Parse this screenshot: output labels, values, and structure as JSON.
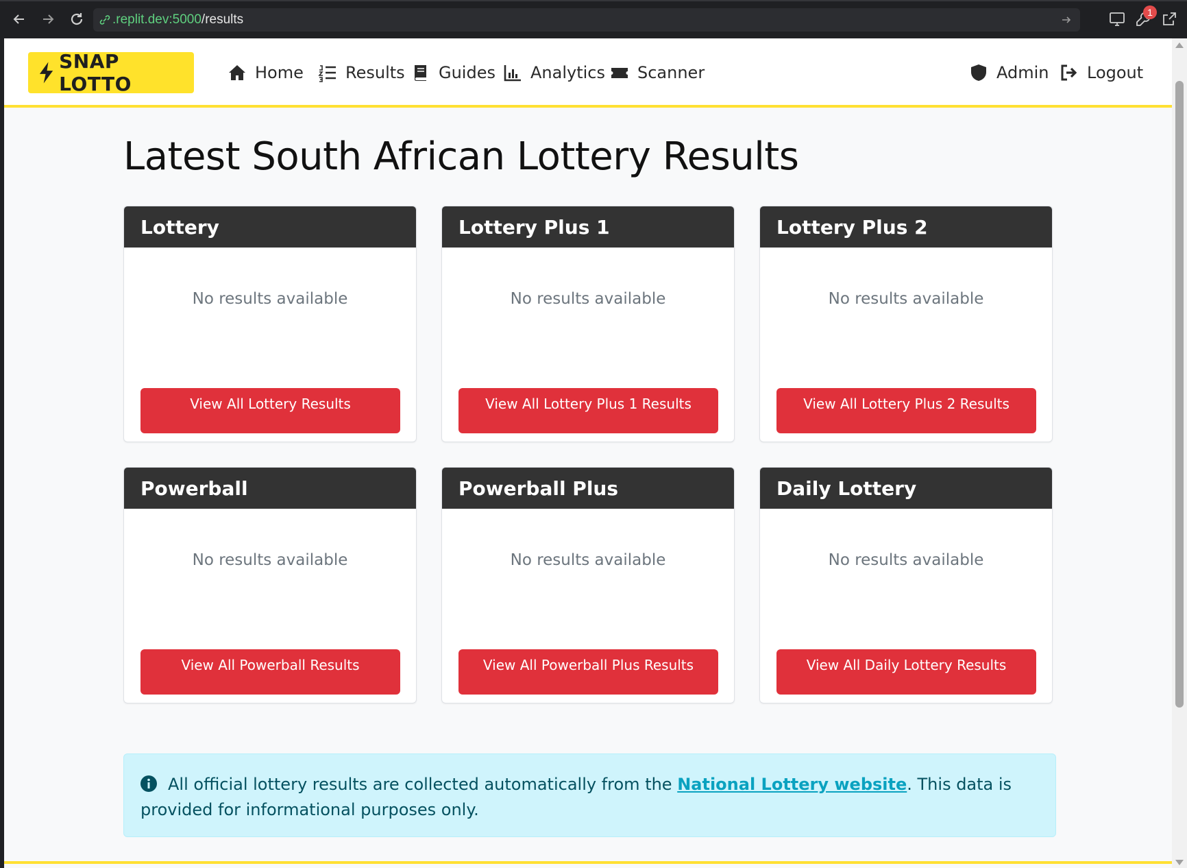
{
  "browser": {
    "url_host": ".replit.dev:5000",
    "url_path": "/results",
    "notification_count": "1"
  },
  "nav": {
    "brand": "SNAP LOTTO",
    "items": [
      {
        "label": "Home",
        "icon": "home-icon"
      },
      {
        "label": "Results",
        "icon": "list-ordered-icon"
      },
      {
        "label": "Guides",
        "icon": "book-icon"
      },
      {
        "label": "Analytics",
        "icon": "chart-icon"
      },
      {
        "label": "Scanner",
        "icon": "ticket-icon"
      }
    ],
    "right_items": [
      {
        "label": "Admin",
        "icon": "shield-icon"
      },
      {
        "label": "Logout",
        "icon": "logout-icon"
      }
    ]
  },
  "page": {
    "title": "Latest South African Lottery Results"
  },
  "cards": [
    {
      "title": "Lottery",
      "empty_text": "No results available",
      "button_label": "View All Lottery Results"
    },
    {
      "title": "Lottery Plus 1",
      "empty_text": "No results available",
      "button_label": "View All Lottery Plus 1 Results"
    },
    {
      "title": "Lottery Plus 2",
      "empty_text": "No results available",
      "button_label": "View All Lottery Plus 2 Results"
    },
    {
      "title": "Powerball",
      "empty_text": "No results available",
      "button_label": "View All Powerball Results"
    },
    {
      "title": "Powerball Plus",
      "empty_text": "No results available",
      "button_label": "View All Powerball Plus Results"
    },
    {
      "title": "Daily Lottery",
      "empty_text": "No results available",
      "button_label": "View All Daily Lottery Results"
    }
  ],
  "info": {
    "text_before": "All official lottery results are collected automatically from the ",
    "link_text": "National Lottery website",
    "text_after": ". This data is provided for informational purposes only."
  },
  "colors": {
    "brand_yellow": "#ffe22b",
    "card_header": "#333333",
    "button_red": "#e0313b",
    "info_bg": "#cff4fc"
  }
}
